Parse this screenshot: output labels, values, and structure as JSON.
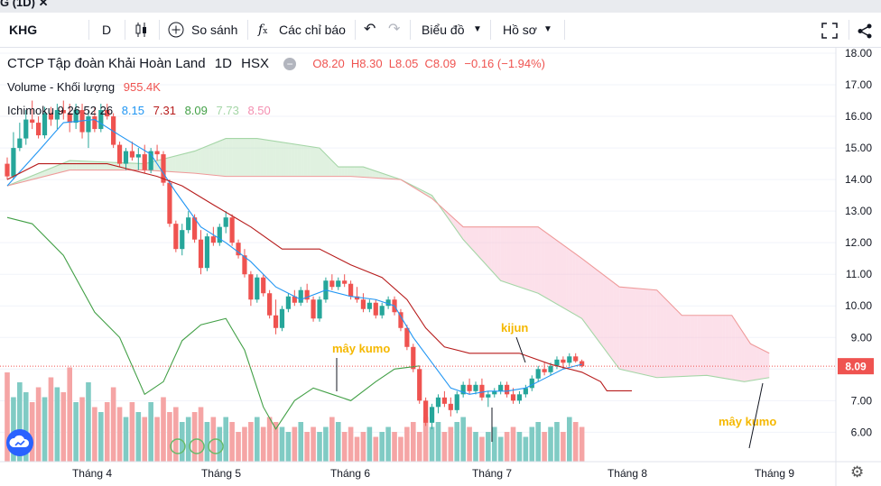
{
  "tab_title": "G (1D) ✕",
  "toolbar": {
    "symbol": "KHG",
    "interval": "D",
    "compare_label": "So sánh",
    "indicators_label": "Các chỉ báo",
    "chart_type_label": "Biểu đồ",
    "profile_label": "Hồ sơ"
  },
  "legend": {
    "name": "CTCP Tập đoàn Khải Hoàn Land",
    "interval": "1D",
    "exchange": "HSX",
    "ohlc": {
      "o": "O8.20",
      "h": "H8.30",
      "l": "L8.05",
      "c": "C8.09",
      "chg": "−0.16 (−1.94%)"
    },
    "volume_label": "Volume - Khối lượng",
    "volume_value": "955.4K",
    "ichimoku_label": "Ichimoku 9 26 52 26",
    "ichimoku_values": [
      "8.15",
      "7.31",
      "8.09",
      "7.73",
      "8.50"
    ]
  },
  "colors": {
    "up": "#26a69a",
    "down": "#ef5350",
    "tenkan": "#2196f3",
    "kijun": "#b71c1c",
    "chikou": "#43a047",
    "cloud_bull": "#a5d6a7",
    "cloud_bear": "#f8bbd0",
    "annotation": "#f5b800"
  },
  "annotations": [
    "kijun",
    "mây kumo",
    "mây kumo"
  ],
  "chart_data": {
    "type": "candlestick",
    "y_axis": {
      "ticks": [
        "18.00",
        "17.00",
        "16.00",
        "15.00",
        "14.00",
        "13.00",
        "12.00",
        "11.00",
        "10.00",
        "9.00",
        "8.00",
        "7.00",
        "6.00"
      ],
      "range": [
        5.0,
        18.3
      ]
    },
    "x_axis": {
      "ticks": [
        "Tháng 4",
        "Tháng 5",
        "Tháng 6",
        "Tháng 7",
        "Tháng 8",
        "Tháng 9"
      ]
    },
    "last_price": "8.09",
    "candles": [
      [
        14.5,
        14.7,
        14.0,
        14.1
      ],
      [
        14.1,
        15.5,
        14.0,
        15.0
      ],
      [
        15.0,
        15.8,
        14.9,
        15.3
      ],
      [
        15.3,
        16.2,
        15.1,
        15.9
      ],
      [
        15.9,
        16.5,
        15.6,
        15.8
      ],
      [
        15.8,
        16.0,
        15.3,
        15.4
      ],
      [
        15.4,
        16.3,
        15.3,
        16.1
      ],
      [
        16.1,
        16.3,
        15.7,
        15.9
      ],
      [
        15.9,
        16.4,
        15.6,
        16.2
      ],
      [
        16.2,
        16.5,
        15.9,
        16.1
      ],
      [
        16.1,
        16.4,
        15.5,
        15.8
      ],
      [
        15.8,
        16.4,
        15.6,
        16.2
      ],
      [
        16.2,
        16.4,
        15.3,
        15.5
      ],
      [
        15.5,
        16.2,
        15.0,
        16.0
      ],
      [
        16.0,
        16.3,
        15.5,
        15.6
      ],
      [
        15.6,
        16.4,
        15.5,
        16.2
      ],
      [
        16.2,
        16.4,
        15.9,
        16.0
      ],
      [
        16.0,
        16.1,
        15.0,
        15.1
      ],
      [
        15.1,
        15.2,
        14.4,
        14.5
      ],
      [
        14.5,
        15.0,
        14.3,
        14.9
      ],
      [
        14.9,
        15.2,
        14.6,
        14.7
      ],
      [
        14.7,
        15.0,
        14.3,
        14.8
      ],
      [
        14.8,
        15.1,
        14.2,
        14.3
      ],
      [
        14.3,
        15.0,
        14.2,
        14.9
      ],
      [
        14.9,
        15.1,
        14.6,
        14.8
      ],
      [
        14.8,
        14.9,
        13.8,
        13.9
      ],
      [
        13.9,
        14.0,
        12.5,
        12.6
      ],
      [
        12.6,
        12.7,
        11.7,
        11.8
      ],
      [
        11.8,
        12.6,
        11.6,
        12.4
      ],
      [
        12.4,
        13.0,
        12.3,
        12.8
      ],
      [
        12.8,
        12.9,
        12.0,
        12.1
      ],
      [
        12.1,
        12.4,
        11.0,
        11.2
      ],
      [
        11.2,
        12.3,
        11.1,
        12.2
      ],
      [
        12.2,
        12.5,
        11.9,
        12.0
      ],
      [
        12.0,
        12.6,
        11.9,
        12.5
      ],
      [
        12.5,
        13.0,
        12.3,
        12.8
      ],
      [
        12.8,
        12.9,
        11.9,
        12.0
      ],
      [
        12.0,
        12.1,
        11.5,
        11.6
      ],
      [
        11.6,
        11.8,
        10.9,
        11.0
      ],
      [
        11.0,
        11.1,
        10.0,
        10.2
      ],
      [
        10.2,
        11.0,
        10.1,
        10.9
      ],
      [
        10.9,
        11.0,
        10.3,
        10.4
      ],
      [
        10.4,
        10.5,
        9.6,
        9.7
      ],
      [
        9.7,
        10.2,
        9.1,
        9.3
      ],
      [
        9.3,
        10.0,
        9.2,
        9.9
      ],
      [
        9.9,
        10.4,
        9.8,
        10.3
      ],
      [
        10.3,
        10.5,
        10.0,
        10.1
      ],
      [
        10.1,
        10.6,
        10.0,
        10.5
      ],
      [
        10.5,
        10.7,
        10.1,
        10.2
      ],
      [
        10.2,
        10.3,
        9.5,
        9.6
      ],
      [
        9.6,
        10.3,
        9.5,
        10.2
      ],
      [
        10.2,
        10.9,
        10.1,
        10.8
      ],
      [
        10.8,
        11.0,
        10.5,
        10.6
      ],
      [
        10.6,
        10.9,
        10.5,
        10.8
      ],
      [
        10.8,
        11.0,
        10.6,
        10.7
      ],
      [
        10.7,
        10.8,
        10.2,
        10.3
      ],
      [
        10.3,
        10.6,
        10.1,
        10.2
      ],
      [
        10.2,
        10.4,
        9.8,
        9.9
      ],
      [
        9.9,
        10.2,
        9.8,
        10.1
      ],
      [
        10.1,
        10.2,
        9.6,
        9.7
      ],
      [
        9.7,
        10.1,
        9.6,
        10.0
      ],
      [
        10.0,
        10.3,
        9.9,
        10.2
      ],
      [
        10.2,
        10.3,
        9.7,
        9.8
      ],
      [
        9.8,
        9.9,
        9.2,
        9.3
      ],
      [
        9.3,
        9.4,
        8.6,
        8.7
      ],
      [
        8.7,
        8.8,
        7.9,
        8.0
      ],
      [
        8.0,
        8.1,
        6.9,
        7.0
      ],
      [
        7.0,
        7.1,
        6.2,
        6.3
      ],
      [
        6.3,
        6.9,
        6.1,
        6.8
      ],
      [
        6.8,
        7.2,
        6.6,
        7.1
      ],
      [
        7.1,
        7.3,
        6.8,
        6.9
      ],
      [
        6.9,
        7.1,
        6.5,
        6.7
      ],
      [
        6.7,
        7.3,
        6.6,
        7.2
      ],
      [
        7.2,
        7.6,
        7.1,
        7.5
      ],
      [
        7.5,
        7.7,
        7.2,
        7.3
      ],
      [
        7.3,
        7.6,
        7.2,
        7.5
      ],
      [
        7.5,
        7.7,
        7.0,
        7.1
      ],
      [
        7.1,
        7.3,
        6.8,
        7.2
      ],
      [
        7.2,
        7.4,
        7.1,
        7.3
      ],
      [
        7.3,
        7.6,
        7.2,
        7.5
      ],
      [
        7.5,
        7.6,
        7.1,
        7.2
      ],
      [
        7.2,
        7.4,
        6.9,
        7.0
      ],
      [
        7.0,
        7.3,
        6.9,
        7.2
      ],
      [
        7.2,
        7.5,
        7.1,
        7.4
      ],
      [
        7.4,
        7.8,
        7.3,
        7.7
      ],
      [
        7.7,
        8.1,
        7.6,
        8.0
      ],
      [
        8.0,
        8.2,
        7.8,
        7.9
      ],
      [
        7.9,
        8.2,
        7.8,
        8.1
      ],
      [
        8.1,
        8.4,
        8.0,
        8.3
      ],
      [
        8.3,
        8.4,
        8.0,
        8.2
      ],
      [
        8.2,
        8.5,
        8.1,
        8.4
      ],
      [
        8.4,
        8.5,
        8.2,
        8.25
      ],
      [
        8.25,
        8.3,
        8.05,
        8.09
      ]
    ],
    "tenkan": [
      [
        0,
        13.8
      ],
      [
        5,
        14.9
      ],
      [
        9,
        15.8
      ],
      [
        14,
        15.9
      ],
      [
        18,
        15.4
      ],
      [
        23,
        14.8
      ],
      [
        27,
        13.6
      ],
      [
        31,
        12.5
      ],
      [
        35,
        12.0
      ],
      [
        39,
        11.4
      ],
      [
        43,
        10.6
      ],
      [
        47,
        10.2
      ],
      [
        51,
        10.5
      ],
      [
        55,
        10.3
      ],
      [
        59,
        10.2
      ],
      [
        62,
        10.0
      ],
      [
        65,
        9.0
      ],
      [
        68,
        8.2
      ],
      [
        71,
        7.4
      ],
      [
        74,
        7.2
      ],
      [
        77,
        7.3
      ],
      [
        80,
        7.3
      ],
      [
        83,
        7.4
      ],
      [
        86,
        7.7
      ],
      [
        89,
        8.0
      ],
      [
        92,
        8.15
      ]
    ],
    "kijun": [
      [
        0,
        14.0
      ],
      [
        5,
        14.5
      ],
      [
        16,
        14.5
      ],
      [
        24,
        14.1
      ],
      [
        28,
        13.8
      ],
      [
        33,
        13.2
      ],
      [
        39,
        12.5
      ],
      [
        44,
        11.8
      ],
      [
        50,
        11.8
      ],
      [
        55,
        11.3
      ],
      [
        60,
        10.9
      ],
      [
        64,
        10.2
      ],
      [
        67,
        9.3
      ],
      [
        70,
        8.7
      ],
      [
        74,
        8.5
      ],
      [
        82,
        8.5
      ],
      [
        87,
        8.15
      ],
      [
        92,
        7.9
      ],
      [
        95,
        7.6
      ],
      [
        96,
        7.31
      ],
      [
        100,
        7.31
      ]
    ],
    "chikou": [
      [
        0,
        12.8
      ],
      [
        4,
        12.6
      ],
      [
        9,
        11.6
      ],
      [
        14,
        9.8
      ],
      [
        18,
        9.0
      ],
      [
        22,
        7.2
      ],
      [
        25,
        7.6
      ],
      [
        28,
        8.9
      ],
      [
        31,
        9.4
      ],
      [
        35,
        9.6
      ],
      [
        38,
        8.6
      ],
      [
        41,
        6.8
      ],
      [
        43,
        6.1
      ],
      [
        46,
        7.0
      ],
      [
        49,
        7.4
      ],
      [
        52,
        7.2
      ],
      [
        55,
        7.0
      ],
      [
        59,
        7.6
      ],
      [
        62,
        8.0
      ],
      [
        66,
        8.1
      ]
    ],
    "cloud_span_a": [
      [
        0,
        13.8
      ],
      [
        10,
        14.6
      ],
      [
        22,
        14.5
      ],
      [
        30,
        14.9
      ],
      [
        35,
        15.3
      ],
      [
        40,
        15.3
      ],
      [
        50,
        15.0
      ],
      [
        53,
        14.4
      ],
      [
        57,
        14.4
      ],
      [
        63,
        14.0
      ],
      [
        68,
        13.5
      ],
      [
        73,
        12.1
      ],
      [
        79,
        10.8
      ],
      [
        85,
        10.4
      ],
      [
        92,
        9.6
      ],
      [
        98,
        8.0
      ],
      [
        104,
        7.73
      ],
      [
        112,
        7.8
      ],
      [
        118,
        7.6
      ],
      [
        122,
        7.73
      ]
    ],
    "cloud_span_b": [
      [
        0,
        13.8
      ],
      [
        10,
        14.3
      ],
      [
        22,
        14.3
      ],
      [
        30,
        14.2
      ],
      [
        35,
        14.1
      ],
      [
        45,
        14.1
      ],
      [
        55,
        14.1
      ],
      [
        63,
        14.0
      ],
      [
        68,
        13.4
      ],
      [
        73,
        12.5
      ],
      [
        79,
        12.5
      ],
      [
        85,
        12.5
      ],
      [
        92,
        11.5
      ],
      [
        98,
        10.6
      ],
      [
        104,
        10.5
      ],
      [
        108,
        9.7
      ],
      [
        116,
        9.7
      ],
      [
        119,
        8.8
      ],
      [
        122,
        8.5
      ]
    ],
    "volume": [
      1.8,
      1.3,
      1.6,
      1.4,
      1.2,
      1.5,
      1.3,
      1.7,
      1.5,
      1.4,
      1.9,
      1.2,
      1.3,
      1.6,
      1.1,
      1.0,
      1.2,
      1.5,
      1.1,
      0.9,
      1.2,
      1.0,
      0.9,
      1.2,
      0.9,
      1.3,
      1.0,
      1.1,
      0.8,
      0.9,
      1.0,
      1.1,
      0.8,
      0.9,
      0.7,
      0.9,
      0.8,
      0.6,
      0.7,
      0.8,
      0.9,
      0.7,
      0.9,
      0.8,
      0.7,
      0.6,
      0.7,
      0.8,
      0.6,
      0.7,
      0.6,
      0.7,
      0.9,
      0.8,
      0.6,
      0.7,
      0.5,
      0.6,
      0.7,
      0.5,
      0.6,
      0.7,
      0.6,
      0.5,
      0.7,
      0.8,
      0.6,
      0.9,
      0.7,
      0.8,
      0.6,
      0.7,
      0.8,
      0.9,
      0.7,
      0.6,
      0.5,
      0.6,
      0.7,
      0.5,
      0.6,
      0.7,
      0.6,
      0.5,
      0.7,
      0.8,
      0.6,
      0.7,
      0.8,
      0.6,
      0.9,
      0.8,
      0.7
    ]
  }
}
